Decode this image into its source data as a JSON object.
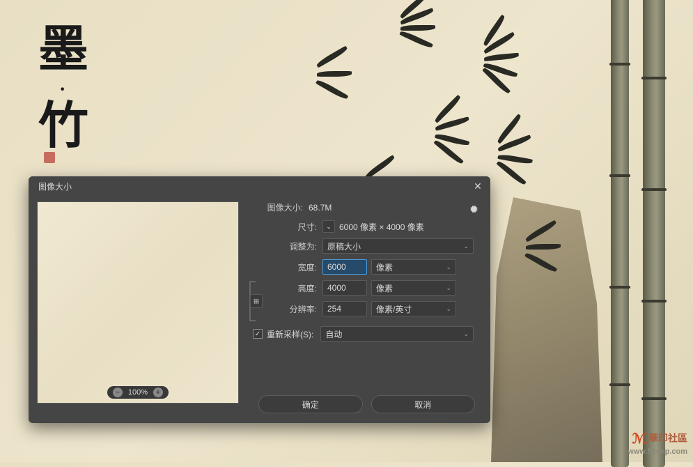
{
  "background": {
    "calligraphy_line1": "墨",
    "calligraphy_line2": "竹"
  },
  "watermark": {
    "text": "華印社區",
    "url": "www.52cnp.com"
  },
  "dialog": {
    "title": "图像大小",
    "close_icon": "✕",
    "info_size_label": "图像大小:",
    "info_size_value": "68.7M",
    "dim_label": "尺寸:",
    "dim_text": "6000 像素 × 4000 像素",
    "fit_label": "调整为:",
    "fit_value": "原稿大小",
    "width_label": "宽度:",
    "width_value": "6000",
    "width_unit": "像素",
    "height_label": "高度:",
    "height_value": "4000",
    "height_unit": "像素",
    "res_label": "分辨率:",
    "res_value": "254",
    "res_unit": "像素/英寸",
    "resample_label": "重新采样(S):",
    "resample_value": "自动",
    "ok": "确定",
    "cancel": "取消",
    "zoom": "100%"
  }
}
